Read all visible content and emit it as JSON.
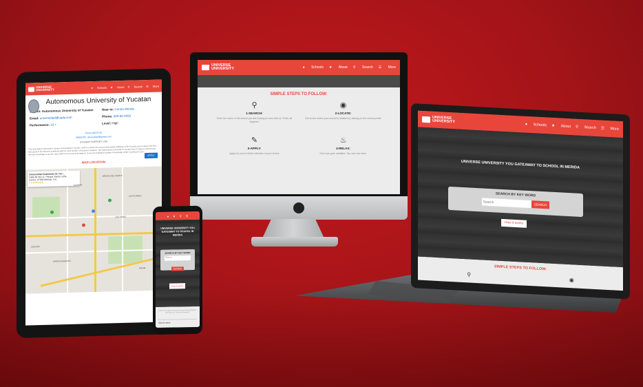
{
  "brand": {
    "name_line1": "UNIVERSE",
    "name_line2": "UNIVERSITY",
    "accent": "#e8463b",
    "background": "#a31418"
  },
  "nav": {
    "schools": "Schools",
    "about": "About",
    "search": "Search",
    "more": "More"
  },
  "desktop": {
    "steps_title": "SIMPLE STEPS TO FOLLOW:",
    "steps": [
      {
        "icon": "magnifier-icon",
        "title": "1-SEARCH:",
        "text": "Enter the name of the school you are looking for and click on \"Enter all degrees\""
      },
      {
        "icon": "location-pin-icon",
        "title": "2-LOCATE:",
        "text": "Get to see where your school is located by clicking on the school profile"
      },
      {
        "icon": "form-icon",
        "title": "3-APPLY:",
        "text": "Apply for you're child's interview of your choice"
      },
      {
        "icon": "relax-icon",
        "title": "4-RELAX:",
        "text": "Once you gets admitted. You can now relax."
      }
    ]
  },
  "laptop": {
    "hero_title": "UNIVERSE UNIVERSITY YOU GATEAWAY TO SCHOOL IN MERIDA",
    "search_label": "SEARCH BY KEY WORD",
    "search_placeholder": "Search",
    "search_button": "SEARCH",
    "how_button": "How it works",
    "steps_title": "SIMPLE STEPS TO FOLLOW:"
  },
  "tablet": {
    "title": "Autonomous University of Yucatan",
    "school_label": "School:",
    "school_value": "Autonomous University of Yucatan",
    "near_label": "Near to:",
    "near_value": "Centro Merida",
    "email_label": "Email:",
    "email_value": "universidad@uady.com",
    "phone_label": "Phone:",
    "phone_value": "999-85-4050",
    "performance_label": "Performance:",
    "performance_value": "10 +",
    "level_label": "Level:",
    "level_value": "High",
    "contact_phone": "Phone:(99-53-55",
    "contact_website": "WEBSITE: universidad@gmail.com",
    "contact_support": "STUDENT SUPPORT: YES",
    "apply_button": "APPLY",
    "description": "This university is Information Yucatan Universidad in Yucatan. UADY is rated in the second best public institution of the Country and is rated in the first best grade in the Mexican southeast with the most number of bachelor's degrees. The Autonomous University of Yucatan has 47 degrees and several relevant knowledge to access, also UADY has several post-degrees. If you are looking for quality of knowledge UADY is perfect for you!",
    "map_title": "MAP LOCATION",
    "map_card_title": "Universidad Autonoma de Yuc...",
    "map_card_line1": "Calle 60 491-A, Parque Santa Lucia,",
    "map_card_line2": "Centro, 97000 Mérida, Yuc.",
    "map_card_rating": "4.4 ★★★★★",
    "map_labels": [
      "ALEMAN",
      "LAS FLORES",
      "CENTRO",
      "GARCIA GINERES",
      "Mérida",
      "BRISAS DEL NORTE",
      "LOS PINOS"
    ]
  },
  "phone": {
    "hero_title": "UNIVERSE UNIVERSITY YOU GATEAWAY TO SCHOOL IN MERIDA",
    "search_label": "SEARCH BY KEY WORD",
    "search_placeholder": "Search",
    "search_button": "SEARCH",
    "how_button": "How it works",
    "bottom_text": "Enter the name of the school you are looking for and click on \"Enter all degrees\"",
    "school_name": "School name"
  }
}
